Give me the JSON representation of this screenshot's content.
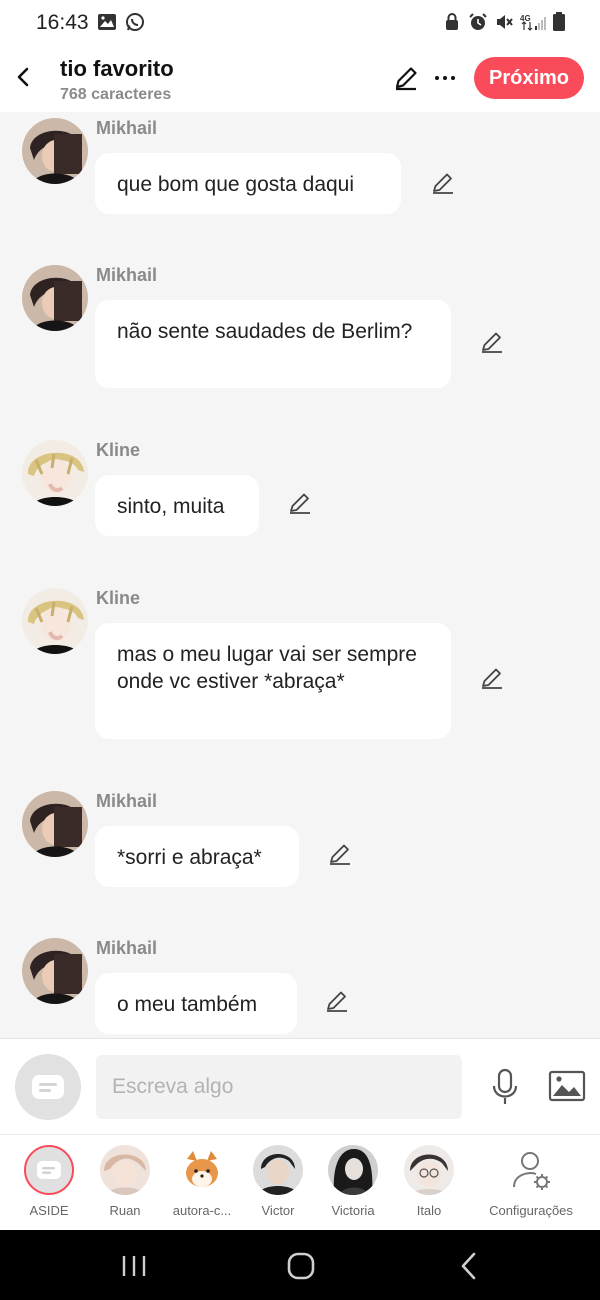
{
  "status_bar": {
    "time": "16:43",
    "left_icons": [
      "gallery-icon",
      "whatsapp-icon"
    ],
    "right_icons": [
      "lock-icon",
      "alarm-icon",
      "mute-icon",
      "4g-signal-icon",
      "battery-icon"
    ]
  },
  "header": {
    "title": "tio favorito",
    "subtitle": "768 caracteres",
    "next_label": "Próximo"
  },
  "messages": [
    {
      "sender": "Mikhail",
      "text": "que bom que gosta daqui"
    },
    {
      "sender": "Mikhail",
      "text": "não sente saudades de Berlim?"
    },
    {
      "sender": "Kline",
      "text": "sinto, muita"
    },
    {
      "sender": "Kline",
      "text": "mas o meu lugar vai ser sempre onde vc estiver *abraça*"
    },
    {
      "sender": "Mikhail",
      "text": "*sorri e abraça*"
    },
    {
      "sender": "Mikhail",
      "text": "o meu também"
    }
  ],
  "input": {
    "placeholder": "Escreva algo"
  },
  "characters": [
    {
      "label": "ASIDE"
    },
    {
      "label": "Ruan"
    },
    {
      "label": "autora-c..."
    },
    {
      "label": "Victor"
    },
    {
      "label": "Victoria"
    },
    {
      "label": "Italo"
    },
    {
      "label": "Configurações"
    }
  ],
  "colors": {
    "accent": "#f94b5a",
    "background": "#f5f5f5",
    "bubble": "#ffffff"
  }
}
